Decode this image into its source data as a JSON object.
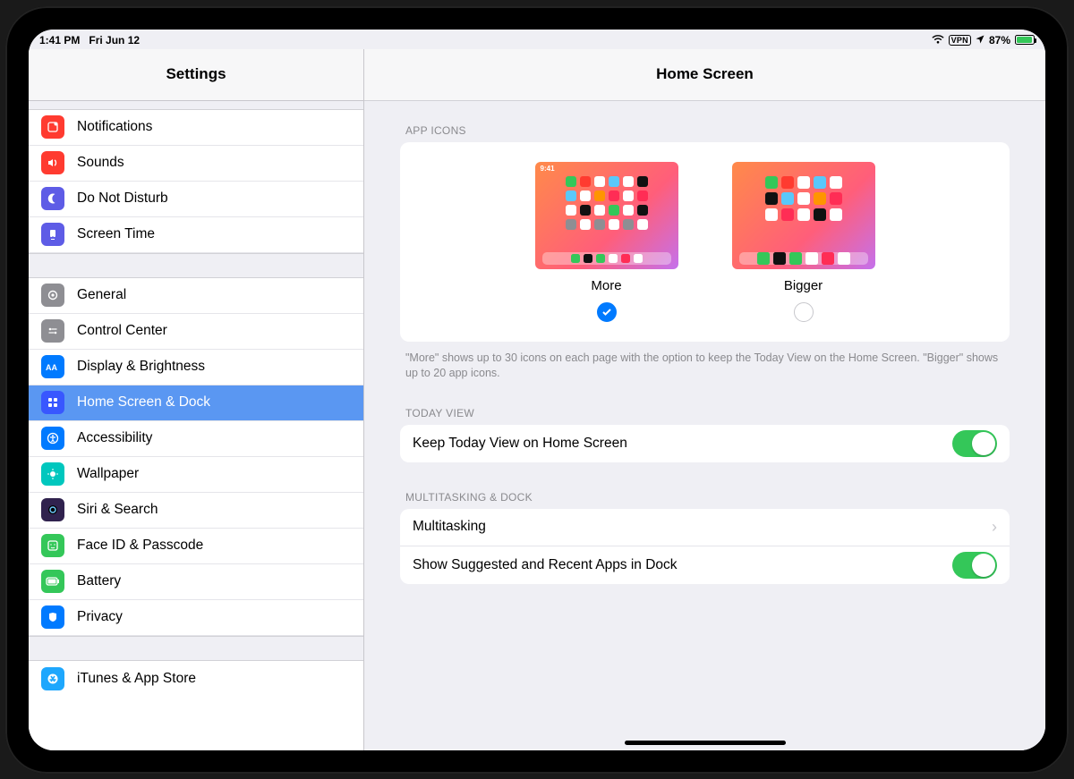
{
  "status": {
    "time": "1:41 PM",
    "date": "Fri Jun 12",
    "vpn_label": "VPN",
    "battery_pct": "87%"
  },
  "sidebar": {
    "title": "Settings",
    "groups": [
      [
        {
          "label": "Notifications",
          "key": "notifications",
          "color": "#ff3b30"
        },
        {
          "label": "Sounds",
          "key": "sounds",
          "color": "#ff3b30"
        },
        {
          "label": "Do Not Disturb",
          "key": "do-not-disturb",
          "color": "#5e5ce6"
        },
        {
          "label": "Screen Time",
          "key": "screen-time",
          "color": "#5e5ce6"
        }
      ],
      [
        {
          "label": "General",
          "key": "general",
          "color": "#8e8e93"
        },
        {
          "label": "Control Center",
          "key": "control-center",
          "color": "#8e8e93"
        },
        {
          "label": "Display & Brightness",
          "key": "display",
          "color": "#007aff"
        },
        {
          "label": "Home Screen & Dock",
          "key": "home-screen-dock",
          "color": "#3857ff",
          "selected": true
        },
        {
          "label": "Accessibility",
          "key": "accessibility",
          "color": "#007aff"
        },
        {
          "label": "Wallpaper",
          "key": "wallpaper",
          "color": "#00c7be"
        },
        {
          "label": "Siri & Search",
          "key": "siri",
          "color": "#30224e"
        },
        {
          "label": "Face ID & Passcode",
          "key": "faceid",
          "color": "#34c759"
        },
        {
          "label": "Battery",
          "key": "battery",
          "color": "#34c759"
        },
        {
          "label": "Privacy",
          "key": "privacy",
          "color": "#007aff"
        }
      ],
      [
        {
          "label": "iTunes & App Store",
          "key": "appstore",
          "color": "#1ea7fd"
        }
      ]
    ]
  },
  "detail": {
    "title": "Home Screen",
    "app_icons": {
      "header": "APP ICONS",
      "options": [
        {
          "key": "more",
          "label": "More",
          "thumb_time": "9:41",
          "selected": true
        },
        {
          "key": "bigger",
          "label": "Bigger",
          "thumb_time": "",
          "selected": false
        }
      ],
      "help": "\"More\" shows up to 30 icons on each page with the option to keep the Today View on the Home Screen. \"Bigger\" shows up to 20 app icons."
    },
    "today_view": {
      "header": "TODAY VIEW",
      "rows": [
        {
          "key": "keep-today-view",
          "label": "Keep Today View on Home Screen",
          "type": "toggle",
          "on": true
        }
      ]
    },
    "multitasking": {
      "header": "MULTITASKING & DOCK",
      "rows": [
        {
          "key": "multitasking",
          "label": "Multitasking",
          "type": "nav"
        },
        {
          "key": "suggested-apps",
          "label": "Show Suggested and Recent Apps in Dock",
          "type": "toggle",
          "on": true
        }
      ]
    }
  }
}
